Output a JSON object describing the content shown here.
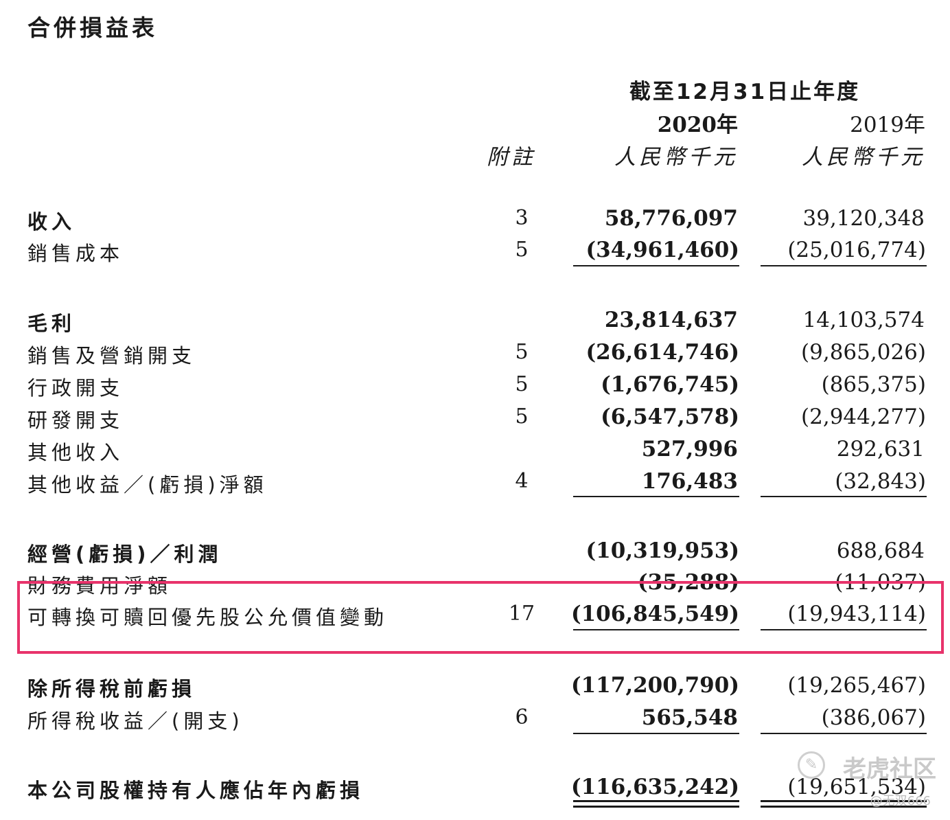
{
  "title": "合併損益表",
  "header": {
    "period": "截至12月31日止年度",
    "year_2020": "2020年",
    "year_2019": "2019年",
    "note": "附註",
    "currency_2020": "人民幣千元",
    "currency_2019": "人民幣千元"
  },
  "rows": [
    {
      "label": "收入",
      "note": "3",
      "v2020": "58,776,097",
      "v2019": "39,120,348"
    },
    {
      "label": "銷售成本",
      "note": "5",
      "v2020": "(34,961,460)",
      "v2019": "(25,016,774)"
    },
    {
      "label": "毛利",
      "note": "",
      "v2020": "23,814,637",
      "v2019": "14,103,574"
    },
    {
      "label": "銷售及營銷開支",
      "note": "5",
      "v2020": "(26,614,746)",
      "v2019": "(9,865,026)"
    },
    {
      "label": "行政開支",
      "note": "5",
      "v2020": "(1,676,745)",
      "v2019": "(865,375)"
    },
    {
      "label": "研發開支",
      "note": "5",
      "v2020": "(6,547,578)",
      "v2019": "(2,944,277)"
    },
    {
      "label": "其他收入",
      "note": "",
      "v2020": "527,996",
      "v2019": "292,631"
    },
    {
      "label": "其他收益／(虧損)淨額",
      "note": "4",
      "v2020": "176,483",
      "v2019": "(32,843)"
    },
    {
      "label": "經營(虧損)／利潤",
      "note": "",
      "v2020": "(10,319,953)",
      "v2019": "688,684"
    },
    {
      "label": "財務費用淨額",
      "note": "",
      "v2020": "(35,288)",
      "v2019": "(11,037)"
    },
    {
      "label": "可轉換可贖回優先股公允價值變動",
      "note": "17",
      "v2020": "(106,845,549)",
      "v2019": "(19,943,114)"
    },
    {
      "label": "除所得稅前虧損",
      "note": "",
      "v2020": "(117,200,790)",
      "v2019": "(19,265,467)"
    },
    {
      "label": "所得稅收益／(開支)",
      "note": "6",
      "v2020": "565,548",
      "v2019": "(386,067)"
    },
    {
      "label": "本公司股權持有人應佔年內虧損",
      "note": "",
      "v2020": "(116,635,242)",
      "v2019": "(19,651,534)"
    }
  ],
  "highlight_color": "#e8336b",
  "watermark": {
    "brand": "老虎社区",
    "user": "@无双666",
    "icon": "tiger-logo-icon"
  }
}
